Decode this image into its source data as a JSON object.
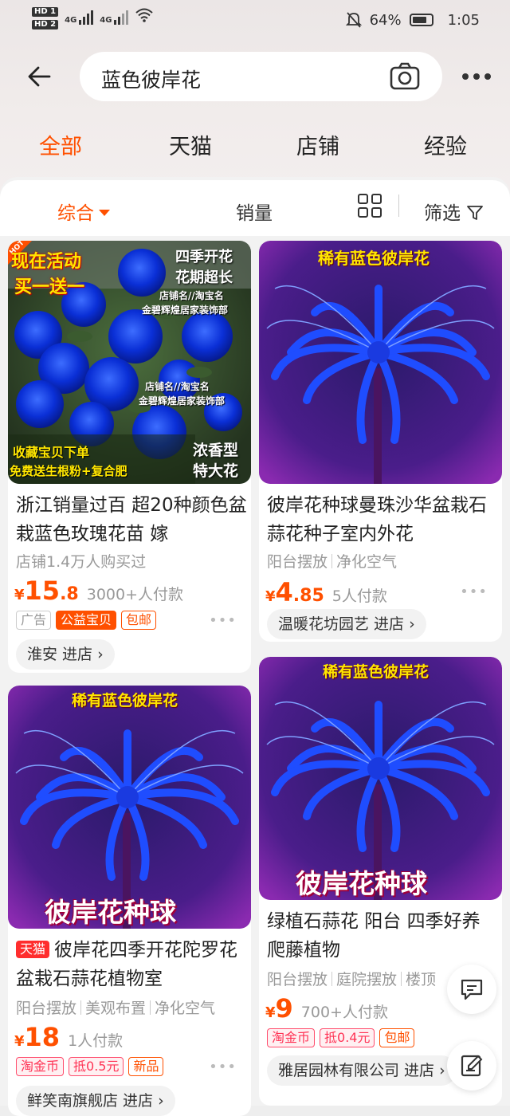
{
  "status": {
    "hd1": "HD 1",
    "hd2": "HD 2",
    "net1": "4G",
    "net2": "4G",
    "battery": "64%",
    "time": "1:05"
  },
  "search": {
    "query": "蓝色彼岸花"
  },
  "tabs": [
    "全部",
    "天猫",
    "店铺",
    "经验"
  ],
  "sort": {
    "comprehensive": "综合",
    "sales": "销量",
    "filter": "筛选"
  },
  "colors": {
    "accent": "#ff5000",
    "tmall": "#ff2e2e"
  },
  "products": [
    {
      "poster": {
        "badge": "HOT",
        "promo1": "现在活动",
        "promo2": "买一送一",
        "season": "四季开花",
        "bloom": "花期超长",
        "shop1": "店铺名//淘宝名",
        "shop2": "金碧辉煌居家装饰部",
        "shop3": "店铺名//淘宝名",
        "shop4": "金碧辉煌居家装饰部",
        "bottom1": "收藏宝贝下单",
        "bottom2": "免费送生根粉+复合肥",
        "right1": "浓香型",
        "right2": "特大花"
      },
      "title": "浙江销量过百 超20种颜色盆栽蓝色玫瑰花苗 嫁",
      "subtitle": "店铺1.4万人购买过",
      "price_cur": "¥",
      "price_int": "15",
      "price_dec": ".8",
      "sold": "3000+人付款",
      "tags": [
        "广告",
        "公益宝贝",
        "包邮"
      ],
      "shop": "淮安 进店"
    },
    {
      "poster": {
        "top": "稀有蓝色彼岸花"
      },
      "title": "彼岸花种球曼珠沙华盆栽石蒜花种子室内外花",
      "attrs": [
        "阳台摆放",
        "净化空气"
      ],
      "price_cur": "¥",
      "price_int": "4",
      "price_dec": ".85",
      "sold": "5人付款",
      "shop": "温暖花坊园艺 进店"
    },
    {
      "poster": {
        "top": "稀有蓝色彼岸花",
        "bottom": "彼岸花种球"
      },
      "tmall_badge": "天猫",
      "title": "彼岸花四季开花陀罗花盆栽石蒜花植物室",
      "attrs": [
        "阳台摆放",
        "美观布置",
        "净化空气"
      ],
      "price_cur": "¥",
      "price_int": "18",
      "price_dec": "",
      "sold": "1人付款",
      "tags": [
        "淘金币",
        "抵0.5元",
        "新品"
      ],
      "shop": "鲜笑南旗舰店 进店"
    },
    {
      "poster": {
        "top": "稀有蓝色彼岸花",
        "bottom": "彼岸花种球"
      },
      "title": "绿植石蒜花 阳台 四季好养爬藤植物",
      "attrs": [
        "阳台摆放",
        "庭院摆放",
        "楼顶"
      ],
      "price_cur": "¥",
      "price_int": "9",
      "price_dec": "",
      "sold": "700+人付款",
      "tags": [
        "淘金币",
        "抵0.4元",
        "包邮"
      ],
      "shop": "雅居园林有限公司 进店"
    }
  ]
}
